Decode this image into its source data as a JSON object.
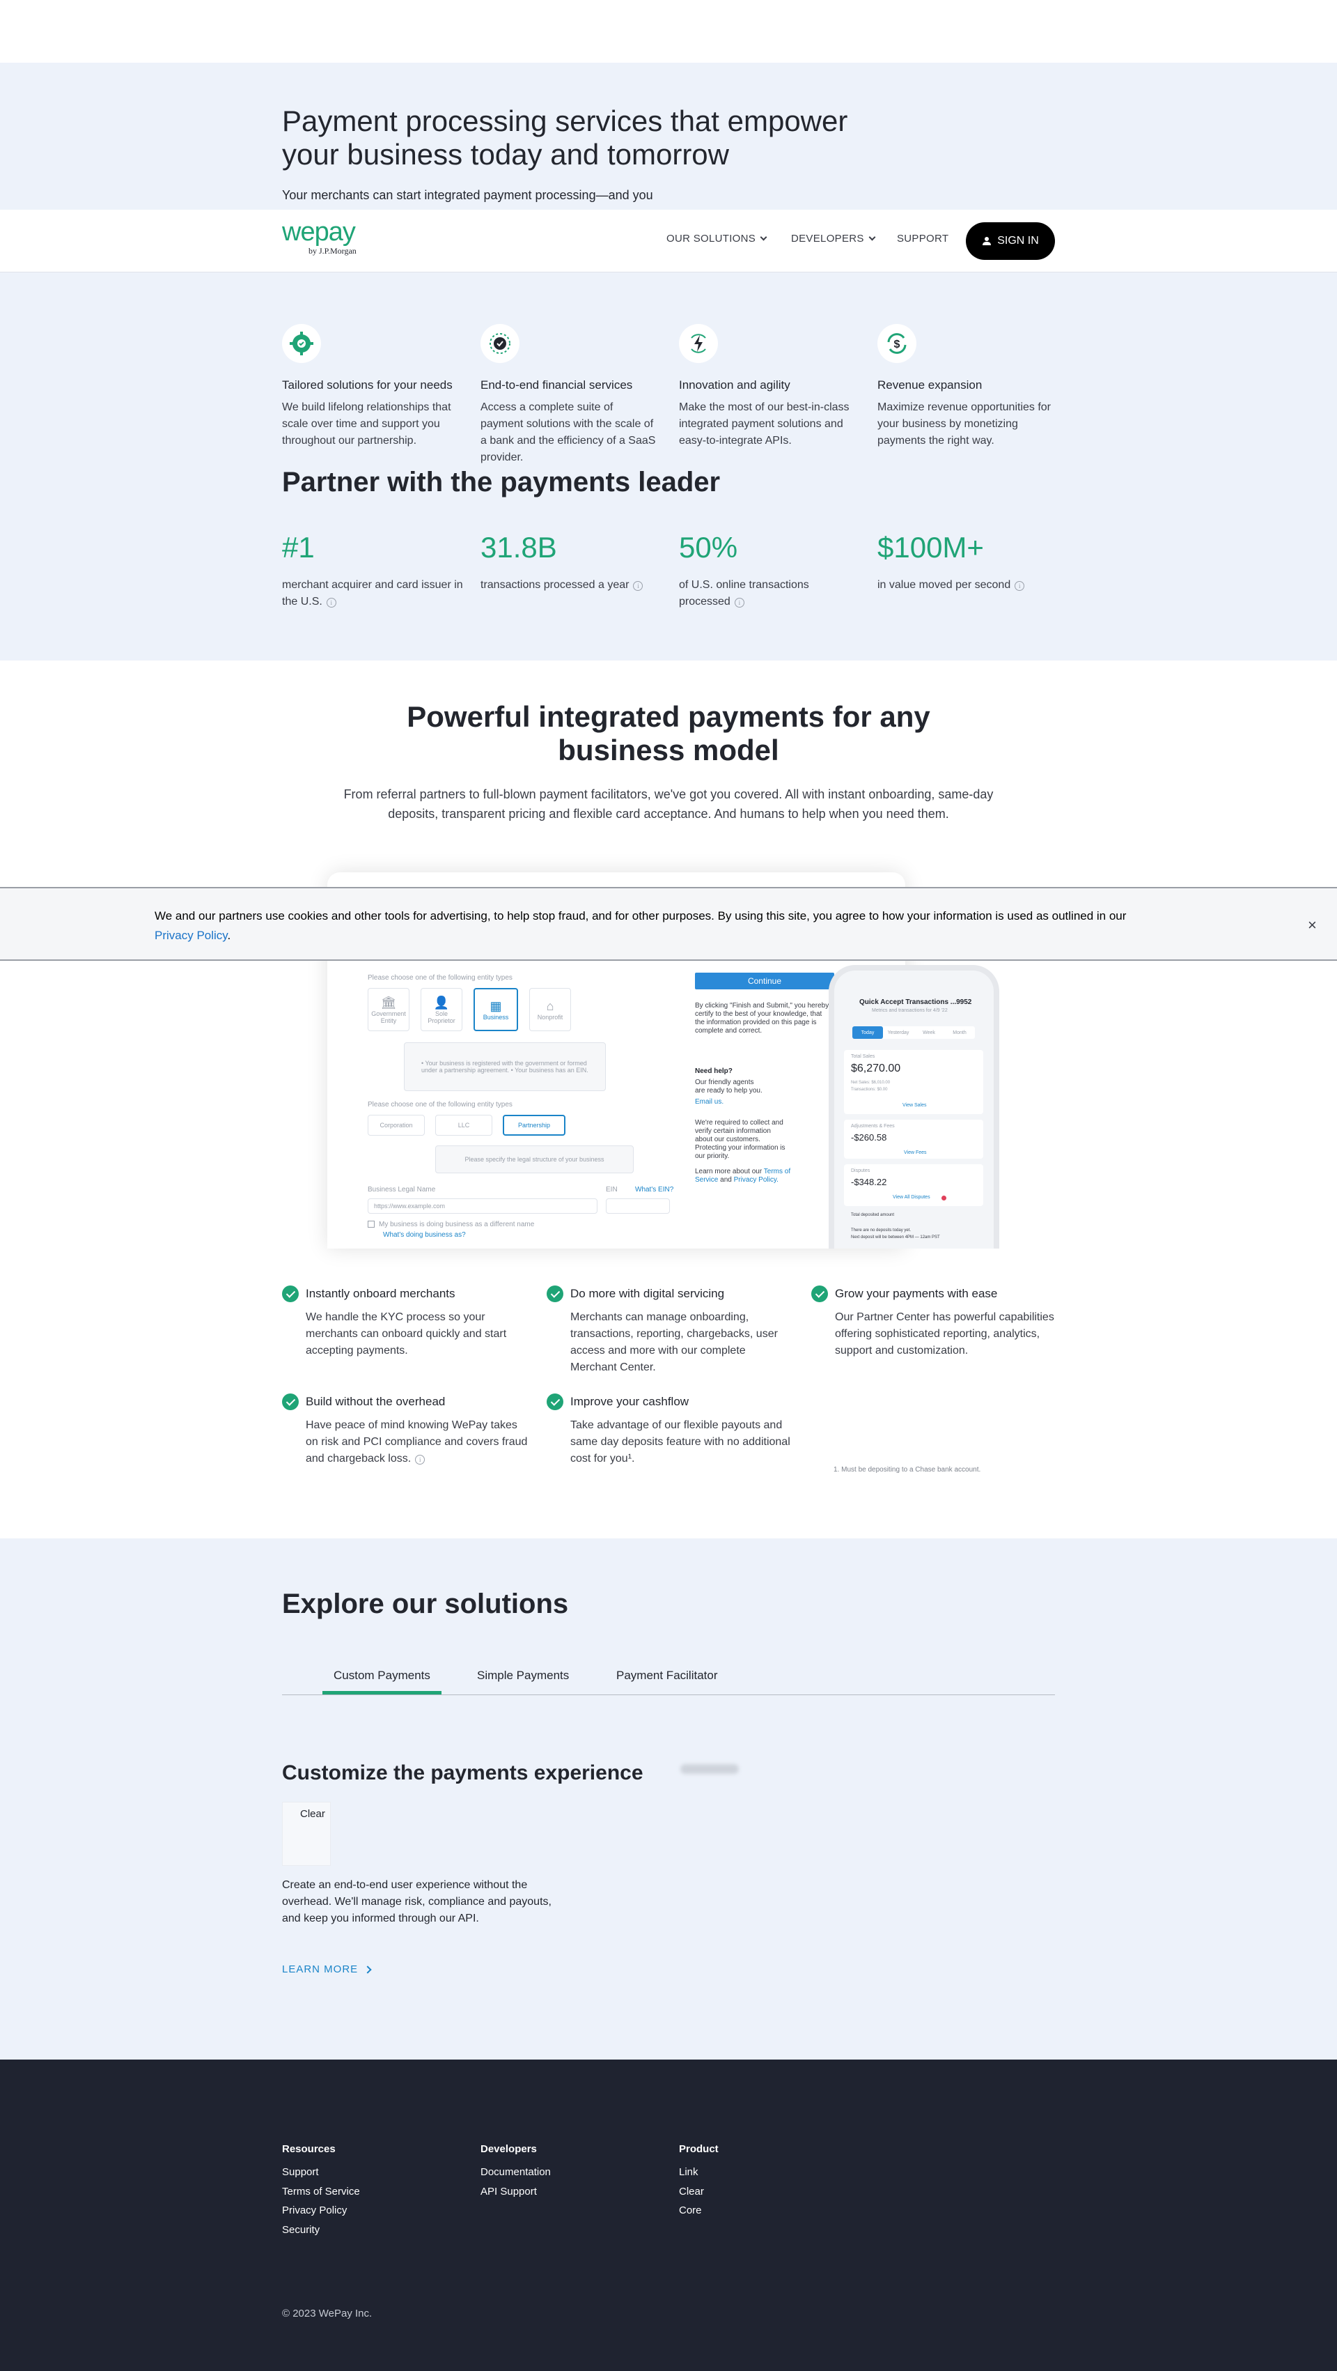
{
  "hero": {
    "title": "Payment processing services that empower your business today and tomorrow",
    "subtitle": "Your merchants can start integrated payment processing—and you"
  },
  "header": {
    "logo": "wepay",
    "logo_sub": "by J.P.Morgan",
    "nav": [
      {
        "label": "OUR SOLUTIONS",
        "dropdown": true
      },
      {
        "label": "DEVELOPERS",
        "dropdown": true
      },
      {
        "label": "SUPPORT",
        "dropdown": false
      }
    ],
    "signin_label": "SIGN IN"
  },
  "features": [
    {
      "icon": "gear-check-icon",
      "title": "Tailored solutions for your needs",
      "desc": "We build lifelong relationships that scale over time and support you throughout our partnership."
    },
    {
      "icon": "badge-check-icon",
      "title": "End-to-end financial services",
      "desc": "Access a complete suite of payment solutions with the scale of a bank and the efficiency of a SaaS provider."
    },
    {
      "icon": "lightning-icon",
      "title": "Innovation and agility",
      "desc": "Make the most of our best-in-class integrated payment solutions and easy-to-integrate APIs."
    },
    {
      "icon": "dollar-cycle-icon",
      "title": "Revenue expansion",
      "desc": "Maximize revenue opportunities for your business by monetizing payments the right way."
    }
  ],
  "partner": {
    "title": "Partner with the payments leader",
    "stats": [
      {
        "value": "#1",
        "label": "merchant acquirer and card issuer in the U.S."
      },
      {
        "value": "31.8B",
        "label": "transactions processed a year"
      },
      {
        "value": "50%",
        "label": "of U.S. online transactions processed"
      },
      {
        "value": "$100M+",
        "label": "in value moved per second"
      }
    ]
  },
  "integrated": {
    "title": "Powerful integrated payments for any business model",
    "desc": "From referral partners to full-blown payment facilitators, we've got you covered. All with instant onboarding, same-day deposits, transparent pricing and flexible card acceptance. And humans to help when you need them."
  },
  "mockup": {
    "entity_prompt": "Please choose one of the following entity types",
    "entity_types": [
      "Government Entity",
      "Sole Proprietor",
      "Business",
      "Nonprofit"
    ],
    "business_notes": "• Your business is registered with the government or formed under a partnership agreement. • Your business has an EIN.",
    "entity_prompt2": "Please choose one of the following entity types",
    "structure_types": [
      "Corporation",
      "LLC",
      "Partnership"
    ],
    "legal_structure_hint": "Please specify the legal structure of your business",
    "legal_name_label": "Business Legal Name",
    "legal_name_placeholder": "https://www.example.com",
    "ein_label": "EIN",
    "whats_ein": "What's EIN?",
    "dba_checkbox": "My business is doing business as a different name",
    "dba_link": "What's doing business as?",
    "continue_label": "Continue",
    "certify_text": "By clicking \"Finish and Submit,\" you hereby certify to the best of your knowledge, that the information provided on this page is complete and correct.",
    "help_title": "Need help?",
    "help_text": "Our friendly agents are ready to help you.",
    "help_link": "Email us.",
    "kyc_text": "We're required to collect and verify certain information about our customers. Protecting your information is our priority.",
    "learn_more_text": "Learn more about our",
    "terms_link": "Terms of Service",
    "and_text": "and",
    "privacy_link": "Privacy Policy.",
    "phone": {
      "title": "Quick Accept Transactions ...9952",
      "subtitle": "Metrics and transactions for 4/9 '22",
      "tabs": [
        "Today",
        "Yesterday",
        "Week",
        "Month"
      ],
      "total_label": "Total Sales",
      "total_value": "$6,270.00",
      "total_detail1": "Net Sales: $6,010.00",
      "total_detail2": "Transactions: $0.00",
      "view_sales": "View Sales",
      "adjust_label": "Adjustments & Fees",
      "adjust_value": "-$260.58",
      "view_fees": "View Fees",
      "dispute_label": "Disputes",
      "dispute_value": "-$348.22",
      "view_disputes": "View All Disputes",
      "deposit_label": "Total deposited amount",
      "deposit_note1": "There are no deposits today yet.",
      "deposit_note2": "Next deposit will be between 4PM — 12am PST"
    }
  },
  "cookie": {
    "text": "We and our partners use cookies and other tools for advertising, to help stop fraud, and for other purposes. By using this site, you agree to how your information is used as outlined in our",
    "link": "Privacy Policy",
    "close": "×"
  },
  "benefits": [
    {
      "title": "Instantly onboard merchants",
      "desc": "We handle the KYC process so your merchants can onboard quickly and start accepting payments."
    },
    {
      "title": "Do more with digital servicing",
      "desc": "Merchants can manage onboarding, transactions, reporting, chargebacks, user access and more with our complete Merchant Center."
    },
    {
      "title": "Grow your payments with ease",
      "desc": "Our Partner Center has powerful capabilities offering sophisticated reporting, analytics, support and customization."
    },
    {
      "title": "Build without the overhead",
      "desc": "Have peace of mind knowing WePay takes on risk and PCI compliance and covers fraud and chargeback loss."
    },
    {
      "title": "Improve your cashflow",
      "desc": "Take advantage of our flexible payouts and same day deposits feature with no additional cost for you¹."
    }
  ],
  "footnote": "1. Must be depositing to a Chase bank account.",
  "explore": {
    "title": "Explore our solutions",
    "tabs": [
      "Custom Payments",
      "Simple Payments",
      "Payment Facilitator"
    ],
    "active_tab": 0,
    "solution_title": "Customize the payments experience",
    "logo_label": "Clear",
    "solution_desc": "Create an end-to-end user experience without the overhead. We'll manage risk, compliance and payouts, and keep you informed through our API.",
    "learn_more": "LEARN MORE"
  },
  "footer": {
    "columns": [
      {
        "heading": "Resources",
        "links": [
          "Support",
          "Terms of Service",
          "Privacy Policy",
          "Security"
        ]
      },
      {
        "heading": "Developers",
        "links": [
          "Documentation",
          "API Support"
        ]
      },
      {
        "heading": "Product",
        "links": [
          "Link",
          "Clear",
          "Core"
        ]
      }
    ],
    "copyright": "© 2023 WePay Inc."
  },
  "colors": {
    "brand_green": "#1fa476",
    "hero_bg": "#edf2fa",
    "footer_bg": "#1f2330",
    "link_blue": "#1a73c8"
  }
}
